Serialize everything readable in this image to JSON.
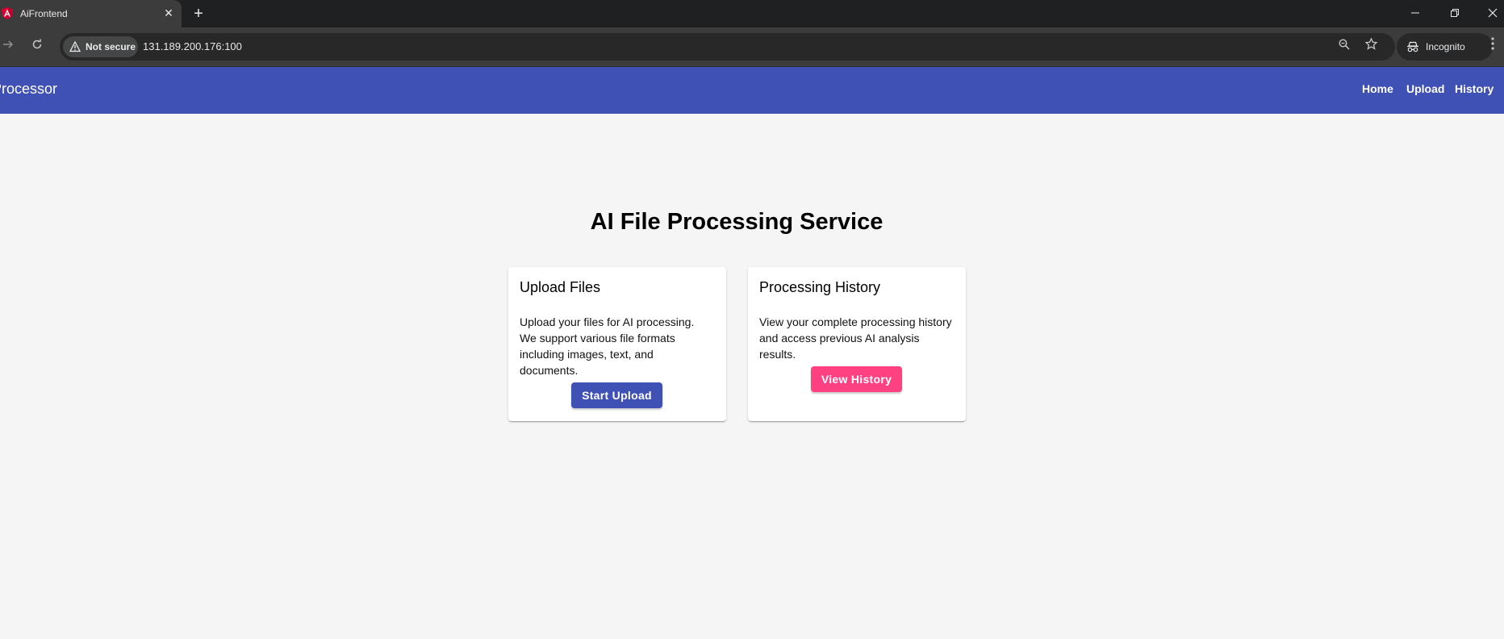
{
  "browser": {
    "tab_title": "AiFrontend",
    "tab_close": "✕",
    "new_tab": "+",
    "security_label": "Not secure",
    "url": "131.189.200.176:100",
    "incognito_label": "Incognito",
    "icons": [
      "back-icon",
      "forward-icon",
      "reload-icon",
      "zoom-icon",
      "bookmark-star-icon",
      "incognito-icon",
      "menu-icon"
    ]
  },
  "app_bar": {
    "title": "Processor",
    "nav": [
      "Home",
      "Upload",
      "History"
    ],
    "color": "#3f51b5"
  },
  "main": {
    "title": "AI File Processing Service",
    "cards": [
      {
        "title": "Upload Files",
        "body": "Upload your files for AI processing. We support various file formats including images, text, and documents.",
        "button": "Start Upload",
        "button_color": "#3f51b5"
      },
      {
        "title": "Processing History",
        "body": "View your complete processing history and access previous AI analysis results.",
        "button": "View History",
        "button_color": "#ff4081"
      }
    ]
  }
}
